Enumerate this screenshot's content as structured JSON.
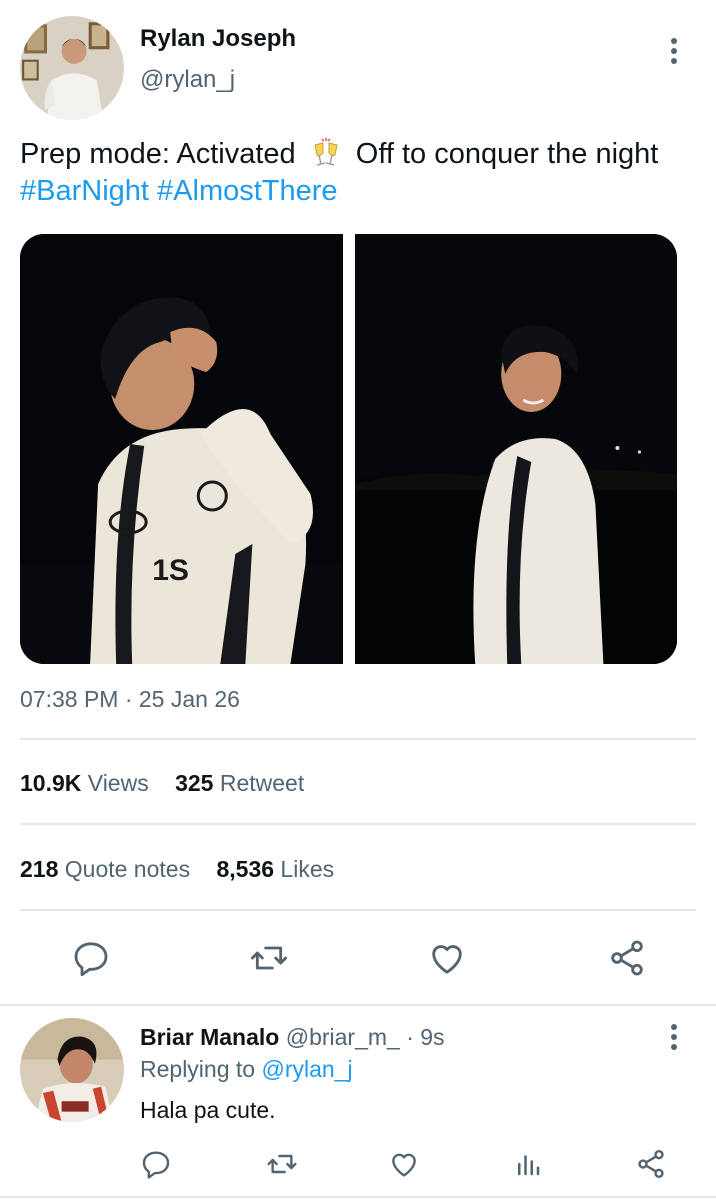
{
  "tweet": {
    "author_name": "Rylan Joseph",
    "author_handle": "@rylan_j",
    "text_before": "Prep mode: Activated",
    "emoji": "clinking-glasses",
    "text_after": "Off to conquer the night",
    "hashtags": [
      "#BarNight",
      "#AlmostThere"
    ],
    "timestamp": "07:38 PM · 25 Jan 26",
    "stats": {
      "views_count": "10.9K",
      "views_label": "Views",
      "retweet_count": "325",
      "retweet_label": "Retweet",
      "quote_count": "218",
      "quote_label": "Quote notes",
      "likes_count": "8,536",
      "likes_label": "Likes"
    },
    "actions": [
      "reply-icon",
      "retweet-icon",
      "like-icon",
      "share-icon"
    ]
  },
  "reply": {
    "author_name": "Briar Manalo",
    "author_handle": "@briar_m_",
    "time": "· 9s",
    "replying_label": "Replying to",
    "replying_to": "@rylan_j",
    "text": "Hala pa cute.",
    "actions": [
      "reply-icon",
      "retweet-icon",
      "like-icon",
      "views-icon",
      "share-icon"
    ]
  },
  "colors": {
    "link": "#1d9bf0",
    "secondary_text": "#536471",
    "primary_text": "#0f1419",
    "divider": "#e5e8eb"
  }
}
